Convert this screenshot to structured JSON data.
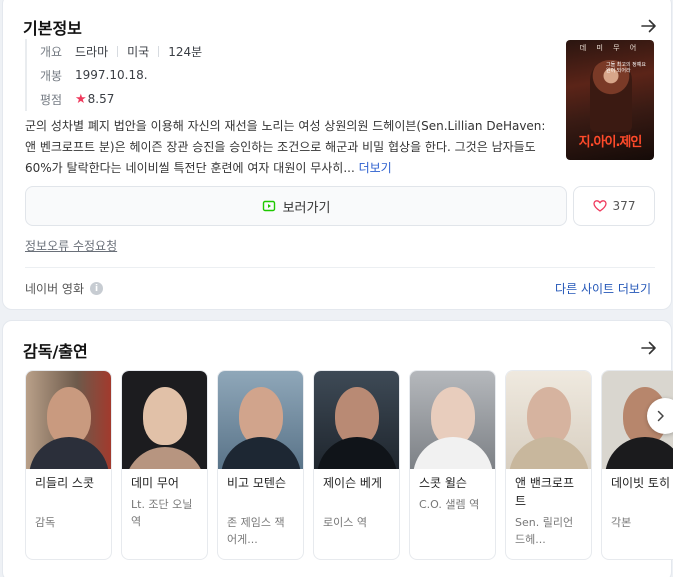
{
  "basic_info": {
    "title": "기본정보",
    "overview_label": "개요",
    "genre": "드라마",
    "country": "미국",
    "runtime": "124분",
    "release_label": "개봉",
    "release_date": "1997.10.18.",
    "rating_label": "평점",
    "rating_star": "★",
    "rating": "8.57",
    "synopsis": "군의 성차별 폐지 법안을 이용해 자신의 재선을 노리는 여성 상원의원 드헤이븐(Sen.Lillian DeHaven: 앤 벤크로프트 분)은 헤이즌 장관 승진을 승인하는 조건으로 해군과 비밀 협상을 한다. 그것은 남자들도 60%가 탈락한다는 네이비씰 특전단 훈련에 여자 대원이 무사히... ",
    "more_label": "더보기",
    "watch_label": "보러가기",
    "like_count": "377",
    "report_label": "정보오류 수정요청",
    "source_label": "네이버 영화",
    "other_sites_label": "다른 사이트 더보기",
    "poster": {
      "top_text": "데 미 무 어",
      "tagline": "그들 최고의 정예요원이 되어라",
      "title": "지.아이.제인"
    }
  },
  "cast_section": {
    "title": "감독/출연",
    "people": [
      {
        "name": "리들리 스콧",
        "role": "감독"
      },
      {
        "name": "데미 무어",
        "role": "Lt. 조단 오닐 역"
      },
      {
        "name": "비고 모텐슨",
        "role": "존 제임스 잭 어게..."
      },
      {
        "name": "제이슨 베게",
        "role": "로이스 역"
      },
      {
        "name": "스콧 윌슨",
        "role": "C.O. 샐렘 역"
      },
      {
        "name": "앤 밴크로프트",
        "role": "Sen. 릴리언 드헤..."
      },
      {
        "name": "데이빗 토히",
        "role": "각본"
      }
    ]
  },
  "colors": {
    "accent_red": "#ef3a5d",
    "link_blue": "#2457b8",
    "watch_icon_green": "#1ec800"
  }
}
